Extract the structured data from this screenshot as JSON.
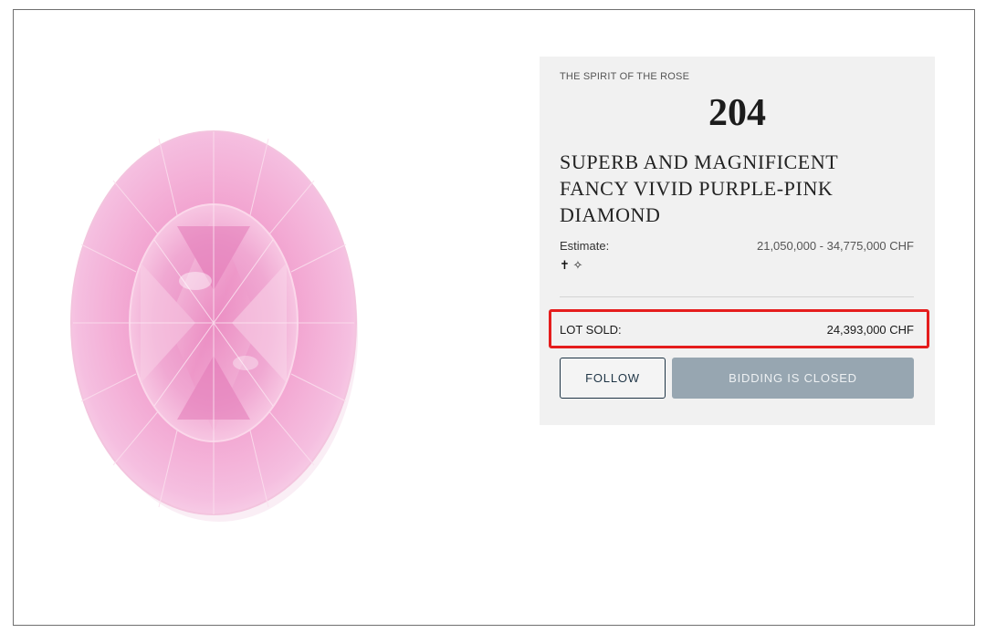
{
  "lot": {
    "sale_title": "THE SPIRIT OF THE ROSE",
    "number": "204",
    "title": "SUPERB AND MAGNIFICENT FANCY VIVID PURPLE-PINK DIAMOND",
    "estimate_label": "Estimate:",
    "estimate_value": "21,050,000 - 34,775,000 CHF",
    "symbols": "✝ ✧",
    "sold_label": "LOT SOLD:",
    "sold_value": "24,393,000 CHF"
  },
  "actions": {
    "follow_label": "FOLLOW",
    "bidding_closed_label": "BIDDING IS CLOSED"
  },
  "colors": {
    "panel_background": "#f1f1f1",
    "highlight_border": "#e51d1d",
    "follow_border": "#1f3546",
    "closed_button": "#97a6b1",
    "diamond_pink": "#f4aed6"
  }
}
